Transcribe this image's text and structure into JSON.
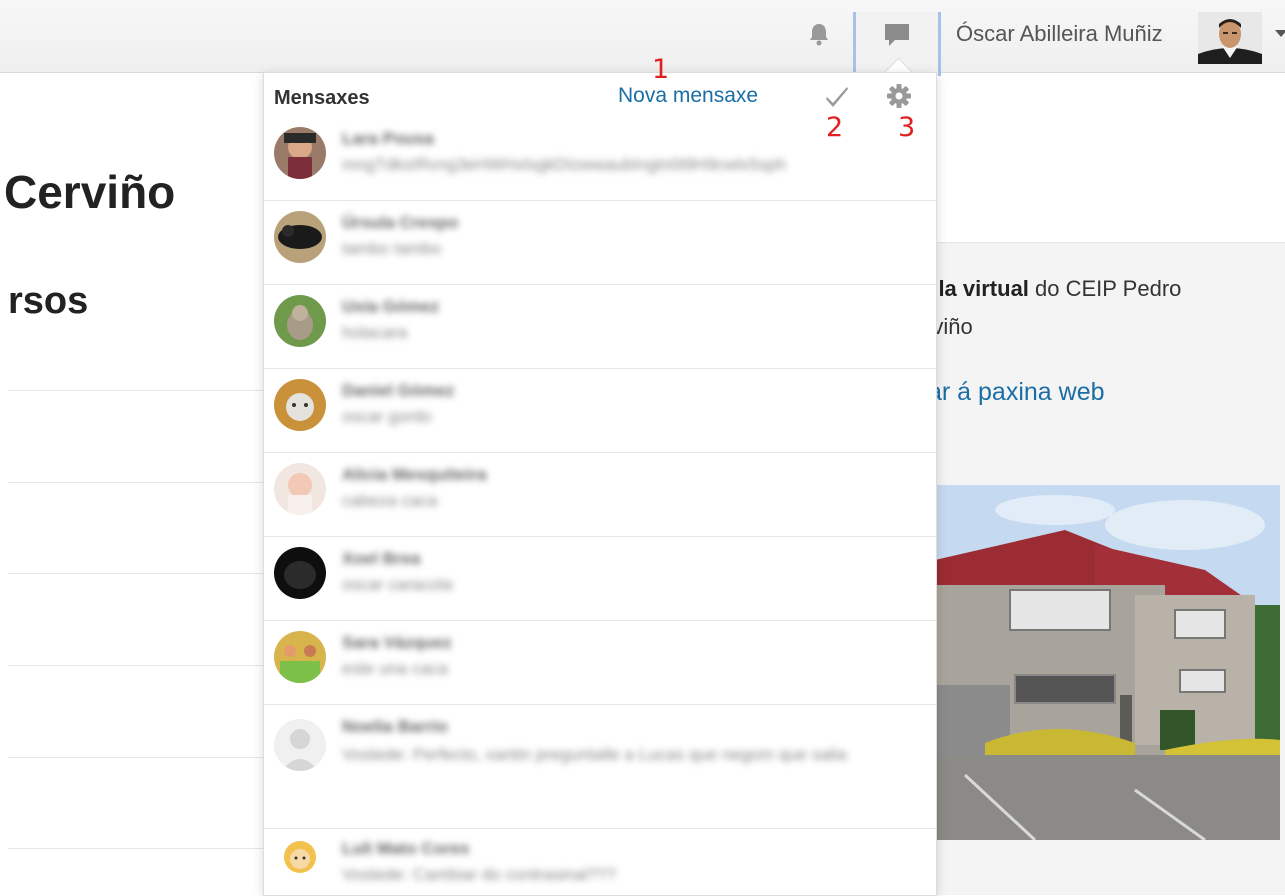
{
  "topbar": {
    "user_name": "Óscar Abilleira Muñiz",
    "icons": [
      "bell-icon",
      "chat-bubble-icon",
      "user-avatar",
      "chevron-down-icon"
    ]
  },
  "background": {
    "title_fragment_1": "Cerviño",
    "title_fragment_2": "rsos",
    "intro_bold": "ula virtual",
    "intro_line1_rest": " do CEIP Pedro",
    "intro_line2": "rviño",
    "web_link": "ar á paxina web"
  },
  "messages_panel": {
    "title": "Mensaxes",
    "new_message_label": "Nova mensaxe",
    "annotations": [
      "1",
      "2",
      "3"
    ],
    "conversations": [
      {
        "name": "Lara Pousa",
        "preview": "mngTdksIRvng3eHWHxlsgkDIzwwaubIngtn0t9H9cwlx5sph"
      },
      {
        "name": "Úrsula Crespo",
        "preview": "tambo tambo"
      },
      {
        "name": "Uxía Gómez",
        "preview": "holacara"
      },
      {
        "name": "Daniel Gómez",
        "preview": "oscar gordo"
      },
      {
        "name": "Alicia Mesquiteira",
        "preview": "cabeza caca"
      },
      {
        "name": "Xoel Brea",
        "preview": "oscar caracola"
      },
      {
        "name": "Sara Vázquez",
        "preview": "este una caca"
      },
      {
        "name": "Noelia Barrio",
        "preview": "Vostede: Perfecto, xantin preguntalle a Lucas que negom que salia"
      },
      {
        "name": "Luli Mato Cores",
        "preview": "Vostede: Cambiar do contrasinal???"
      }
    ]
  }
}
